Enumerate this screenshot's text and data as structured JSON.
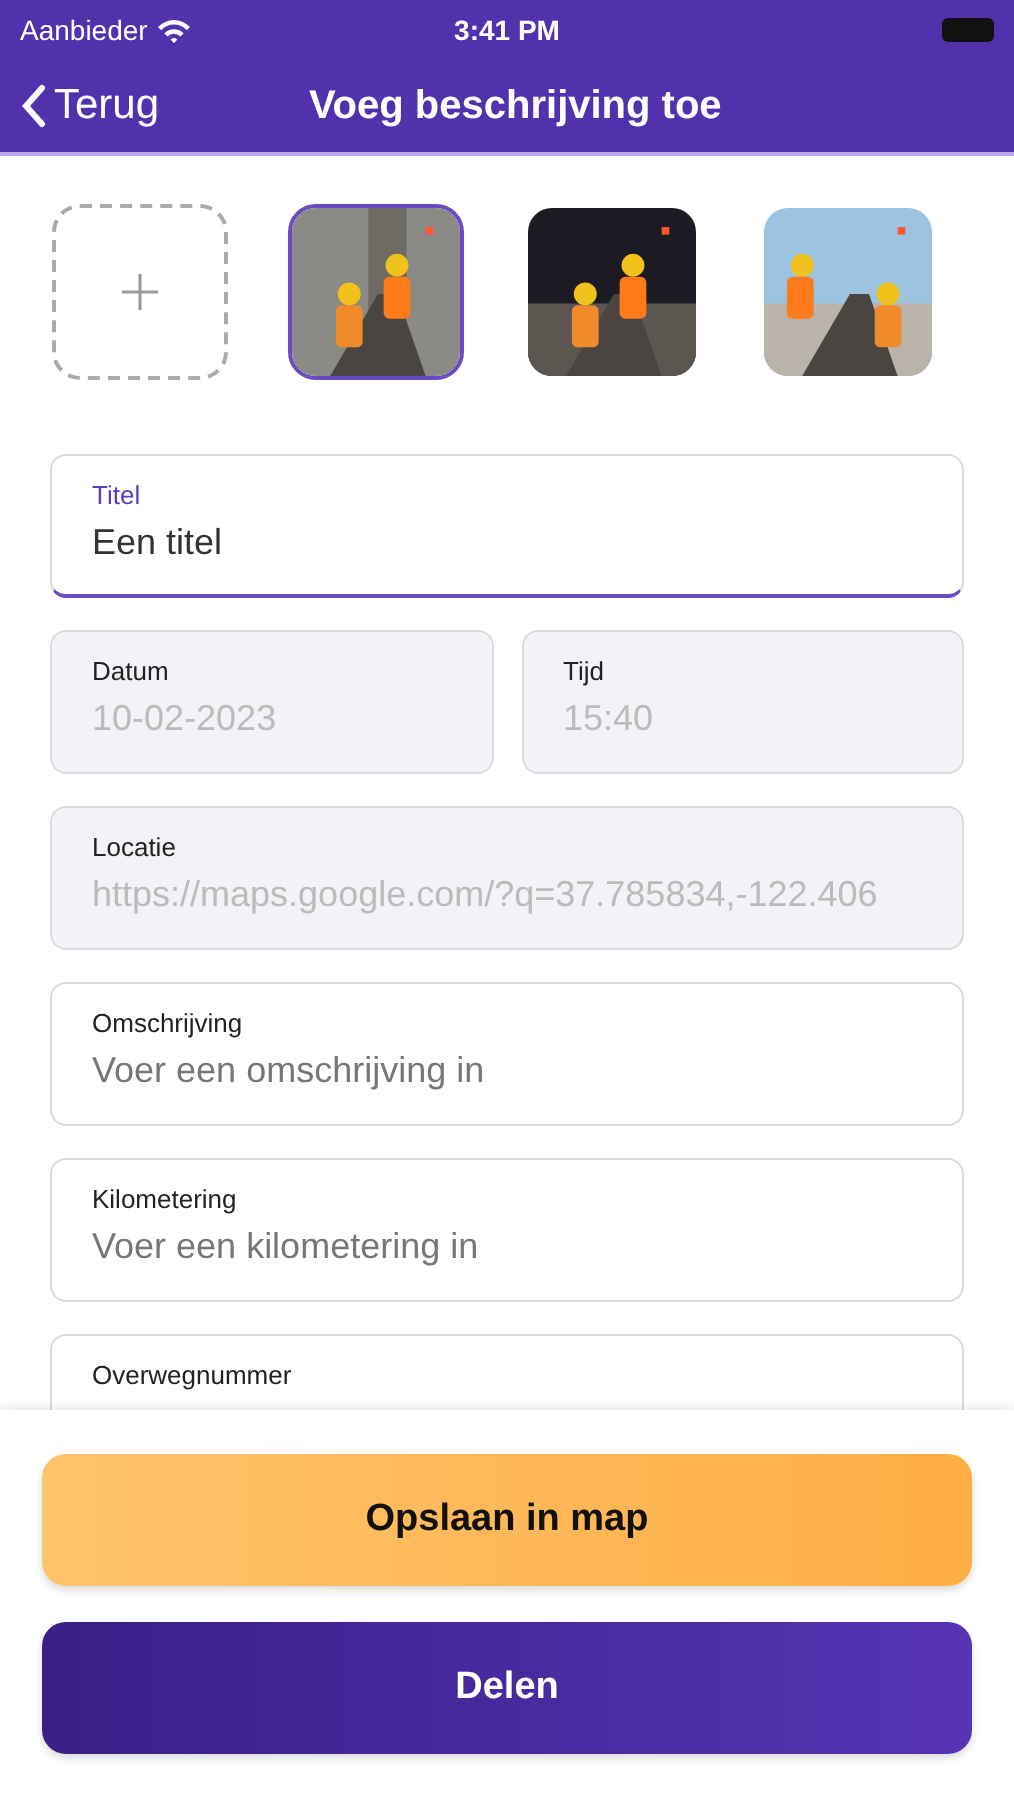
{
  "status_bar": {
    "carrier": "Aanbieder",
    "time": "3:41 PM"
  },
  "nav": {
    "back": "Terug",
    "title": "Voeg beschrijving toe"
  },
  "photos": [
    {
      "kind": "picture",
      "selected": true
    },
    {
      "kind": "picture",
      "selected": false
    },
    {
      "kind": "picture",
      "selected": false
    }
  ],
  "rows": [
    {
      "fields": [
        {
          "label": "Titel",
          "value": "Een titel",
          "focused": true,
          "disabled": false
        }
      ]
    },
    {
      "fields": [
        {
          "label": "Datum",
          "value": "10-02-2023",
          "focused": false,
          "disabled": true
        },
        {
          "label": "Tijd",
          "value": "15:40",
          "focused": false,
          "disabled": true
        }
      ]
    },
    {
      "fields": [
        {
          "label": "Locatie",
          "value": "https://maps.google.com/?q=37.785834,-122.406",
          "focused": false,
          "disabled": true
        }
      ]
    },
    {
      "fields": [
        {
          "label": "Omschrijving",
          "placeholder": "Voer een omschrijving in",
          "focused": false,
          "disabled": false
        }
      ]
    },
    {
      "fields": [
        {
          "label": "Kilometering",
          "placeholder": "Voer een kilometering in",
          "focused": false,
          "disabled": false
        }
      ]
    },
    {
      "fields": [
        {
          "label": "Overwegnummer",
          "focused": false,
          "disabled": false
        }
      ]
    }
  ],
  "buttons": [
    {
      "kind": "primary",
      "label": "Opslaan in map"
    },
    {
      "kind": "secondary",
      "label": "Delen"
    }
  ]
}
